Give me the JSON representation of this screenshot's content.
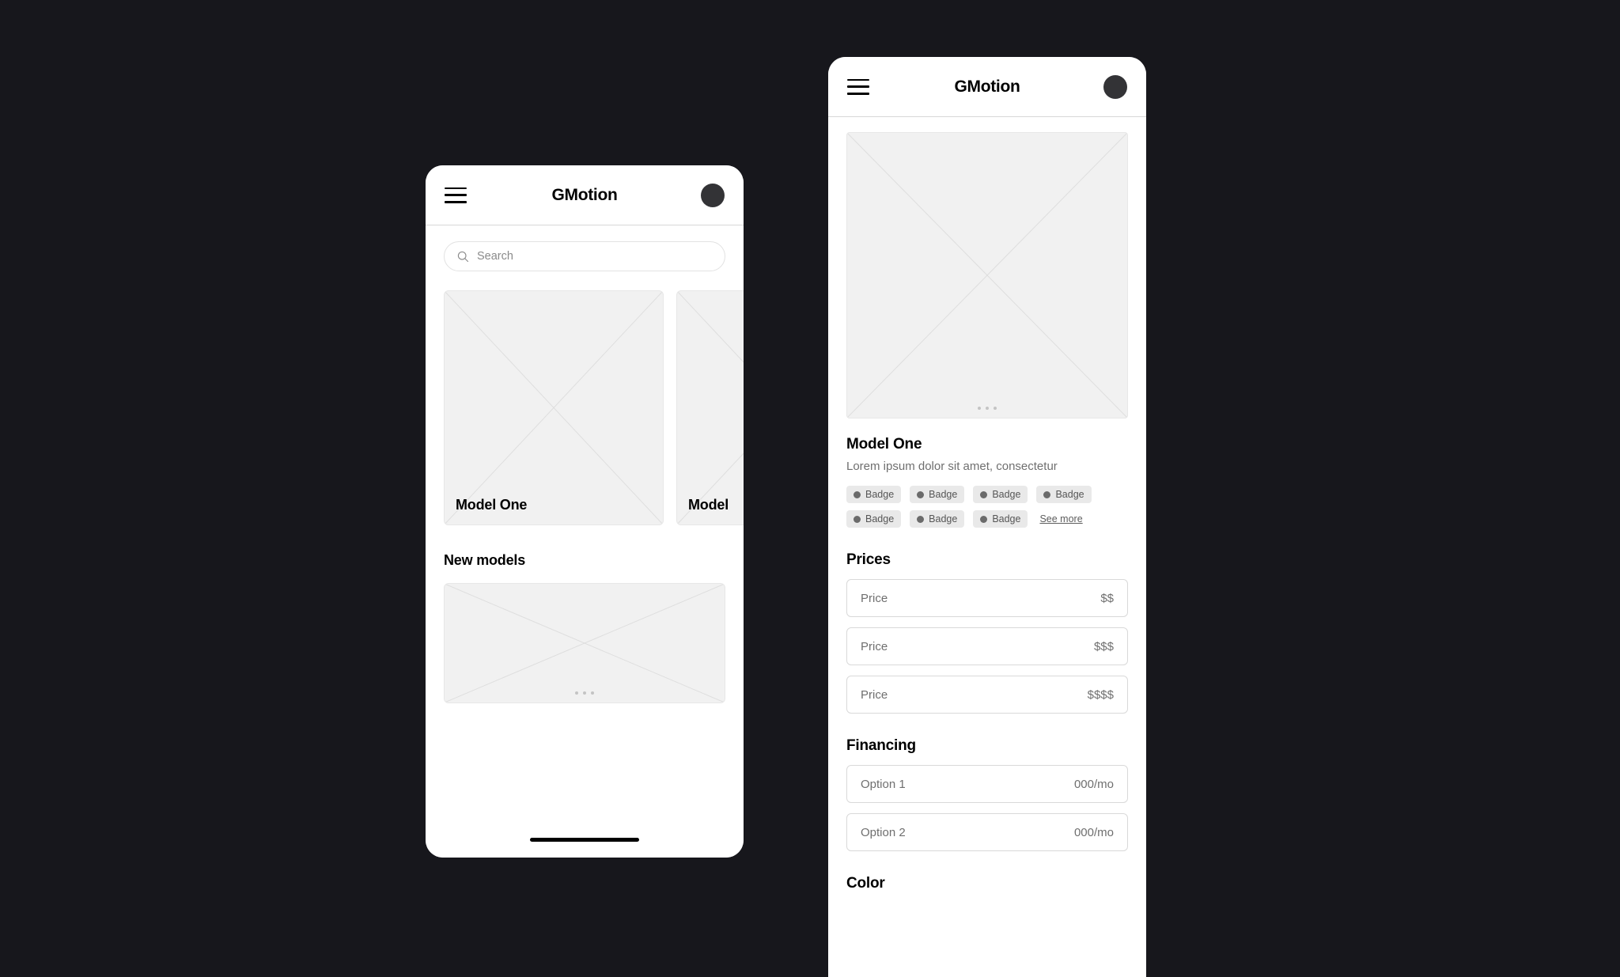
{
  "background_color": "#17171c",
  "phone_one": {
    "appbar": {
      "menu_icon": "hamburger-menu-icon",
      "title": "GMotion",
      "avatar_icon": "avatar-circle"
    },
    "search": {
      "icon": "search-icon",
      "placeholder": "Search",
      "value": ""
    },
    "featured_cards": [
      {
        "label": "Model One"
      },
      {
        "label": "Model"
      }
    ],
    "new_models": {
      "heading": "New models",
      "banner_dots": 3
    }
  },
  "phone_two": {
    "appbar": {
      "menu_icon": "hamburger-menu-icon",
      "title": "GMotion",
      "avatar_icon": "avatar-circle"
    },
    "hero": {
      "dots": 3
    },
    "product": {
      "title": "Model One",
      "description": "Lorem ipsum dolor sit amet, consectetur"
    },
    "badges": [
      {
        "label": "Badge"
      },
      {
        "label": "Badge"
      },
      {
        "label": "Badge"
      },
      {
        "label": "Badge"
      },
      {
        "label": "Badge"
      },
      {
        "label": "Badge"
      },
      {
        "label": "Badge"
      }
    ],
    "see_more_label": "See more",
    "prices": {
      "heading": "Prices",
      "rows": [
        {
          "label": "Price",
          "value": "$$"
        },
        {
          "label": "Price",
          "value": "$$$"
        },
        {
          "label": "Price",
          "value": "$$$$"
        }
      ]
    },
    "financing": {
      "heading": "Financing",
      "rows": [
        {
          "label": "Option 1",
          "value": "000/mo"
        },
        {
          "label": "Option 2",
          "value": "000/mo"
        }
      ]
    },
    "color": {
      "heading": "Color"
    }
  }
}
